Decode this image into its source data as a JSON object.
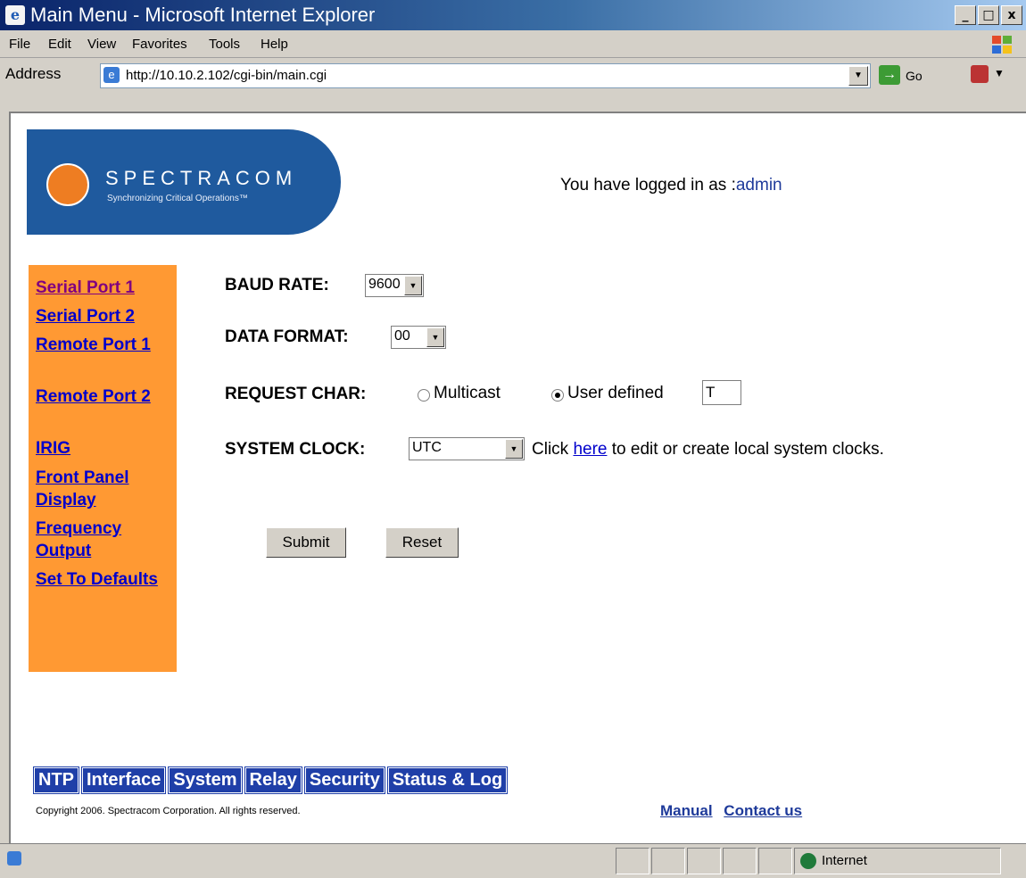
{
  "window": {
    "title": "Main Menu - Microsoft Internet Explorer",
    "buttons": [
      "_",
      "□",
      "x"
    ]
  },
  "menu": [
    "File",
    "Edit",
    "View",
    "Favorites",
    "Tools",
    "Help"
  ],
  "address": {
    "label": "Address",
    "url": "http://10.10.2.102/cgi-bin/main.cgi",
    "go_label": "Go"
  },
  "header": {
    "logo_text": "SPECTRACOM",
    "logo_tagline": "Synchronizing Critical Operations™",
    "login_prefix": "You have logged in as :",
    "login_user": "admin"
  },
  "sidebar": {
    "items": [
      {
        "label": "Serial Port 1"
      },
      {
        "label": "Serial Port 2"
      },
      {
        "label": "Remote Port 1"
      },
      {
        "label": "Remote Port 2"
      },
      {
        "label": "IRIG"
      },
      {
        "label": "Front Panel Display"
      },
      {
        "label": "Frequency Output"
      },
      {
        "label": "Set To Defaults"
      }
    ]
  },
  "form": {
    "baud_label": "BAUD RATE:",
    "baud_value": "9600",
    "format_label": "DATA FORMAT:",
    "format_value": "00",
    "request_label": "REQUEST CHAR:",
    "request_opt1": "Multicast",
    "request_opt2": "User defined",
    "request_value": "T",
    "clock_label": "SYSTEM CLOCK:",
    "clock_value": "UTC",
    "clock_hint_pre": "Click",
    "clock_hint_link": "here",
    "clock_hint_post": "to edit or create local system clocks.",
    "submit_label": "Submit",
    "reset_label": "Reset"
  },
  "bottom_nav": [
    "NTP",
    "Interface",
    "System",
    "Relay",
    "Security",
    "Status & Log"
  ],
  "footer": {
    "copyright": "Copyright 2006. Spectracom Corporation. All rights reserved.",
    "manual": "Manual",
    "contact": "Contact us"
  },
  "status": {
    "zone": "Internet"
  }
}
